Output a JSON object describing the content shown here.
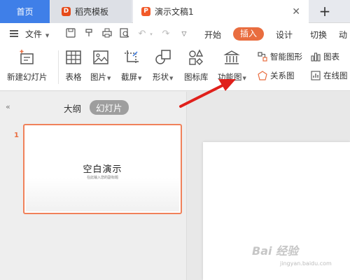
{
  "tabs": {
    "home": "首页",
    "template": "稻壳模板",
    "document": "演示文稿1",
    "template_icon_glyph": "D",
    "document_icon_glyph": "P",
    "close_glyph": "✕",
    "add_glyph": "+"
  },
  "menu": {
    "file": "文件",
    "tabs": [
      "开始",
      "插入",
      "设计",
      "切换",
      "动"
    ],
    "active_tab": "插入",
    "accent_color": "#e96d3f"
  },
  "ribbon": {
    "new_slide": "新建幻灯片",
    "table": "表格",
    "picture": "图片",
    "screenshot": "截屏",
    "shape": "形状",
    "icon_library": "图标库",
    "function_chart": "功能图",
    "smart_graphic": "智能图形",
    "relation_chart": "关系图",
    "chart": "图表",
    "online_chart": "在线图"
  },
  "panel": {
    "collapse_glyph": "«",
    "outline_tab": "大纲",
    "slides_tab": "幻灯片",
    "slide_number": "1",
    "slide_title": "空白演示",
    "slide_subtitle": "在此输入您的副标题"
  },
  "watermark": {
    "text": "Bai 经验",
    "sub": "jingyan.baidu.com"
  }
}
